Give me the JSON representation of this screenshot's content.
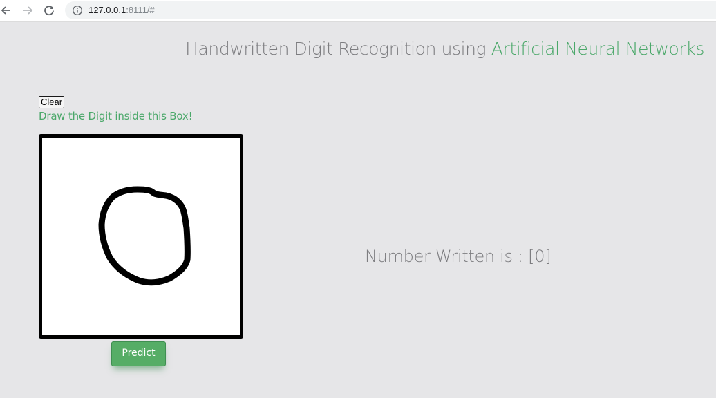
{
  "browser": {
    "url_host": "127.0.0.1",
    "url_rest": ":8111/#",
    "icons": {
      "back": "arrow-left-icon",
      "forward": "arrow-right-icon",
      "reload": "reload-icon",
      "info": "info-icon"
    }
  },
  "header": {
    "title_prefix": "Handwritten Digit Recognition using ",
    "title_accent": "Artificial Neural Networks"
  },
  "controls": {
    "clear_label": "Clear",
    "instruction": "Draw the Digit inside this Box!",
    "predict_label": "Predict"
  },
  "result": {
    "label": "Number Written is : [0]"
  },
  "colors": {
    "background": "#e6e6e8",
    "accent_green": "#4ba86a",
    "title_gray": "#7d7d80",
    "button_green": "#56ad66"
  }
}
